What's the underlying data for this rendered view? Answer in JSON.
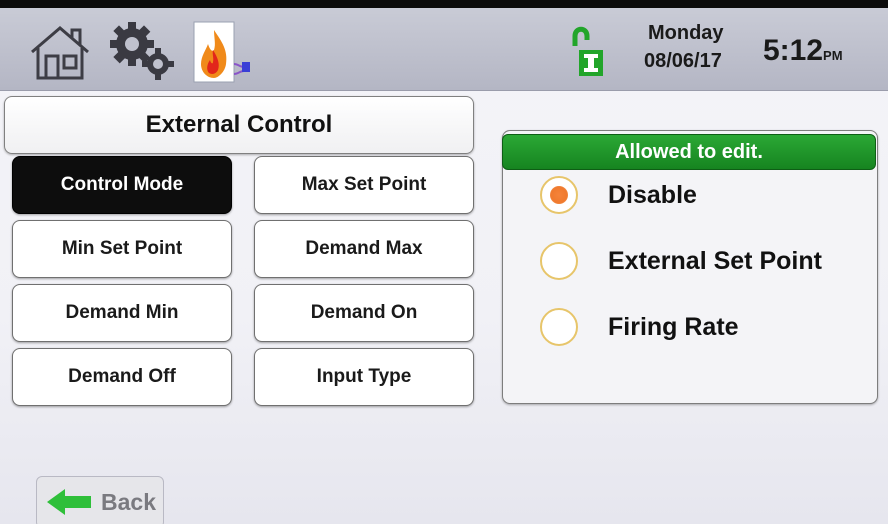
{
  "header": {
    "day": "Monday",
    "date": "08/06/17",
    "time": "5:12",
    "ampm": "PM",
    "icons": [
      "home-icon",
      "gear-icon",
      "burner-icon",
      "unlock-icon"
    ]
  },
  "main": {
    "title": "External Control",
    "buttons": [
      {
        "label": "Control Mode",
        "active": true
      },
      {
        "label": "Max Set Point"
      },
      {
        "label": "Min Set Point"
      },
      {
        "label": "Demand Max"
      },
      {
        "label": "Demand Min"
      },
      {
        "label": "Demand On"
      },
      {
        "label": "Demand Off"
      },
      {
        "label": "Input Type"
      }
    ]
  },
  "panel": {
    "status": "Allowed to edit.",
    "status_color": "#1f9a2a",
    "options": [
      {
        "label": "Disable",
        "selected": true
      },
      {
        "label": "External Set Point",
        "selected": false
      },
      {
        "label": "Firing Rate",
        "selected": false
      }
    ]
  },
  "footer": {
    "back_label": "Back",
    "back_icon": "arrow-left-icon"
  }
}
